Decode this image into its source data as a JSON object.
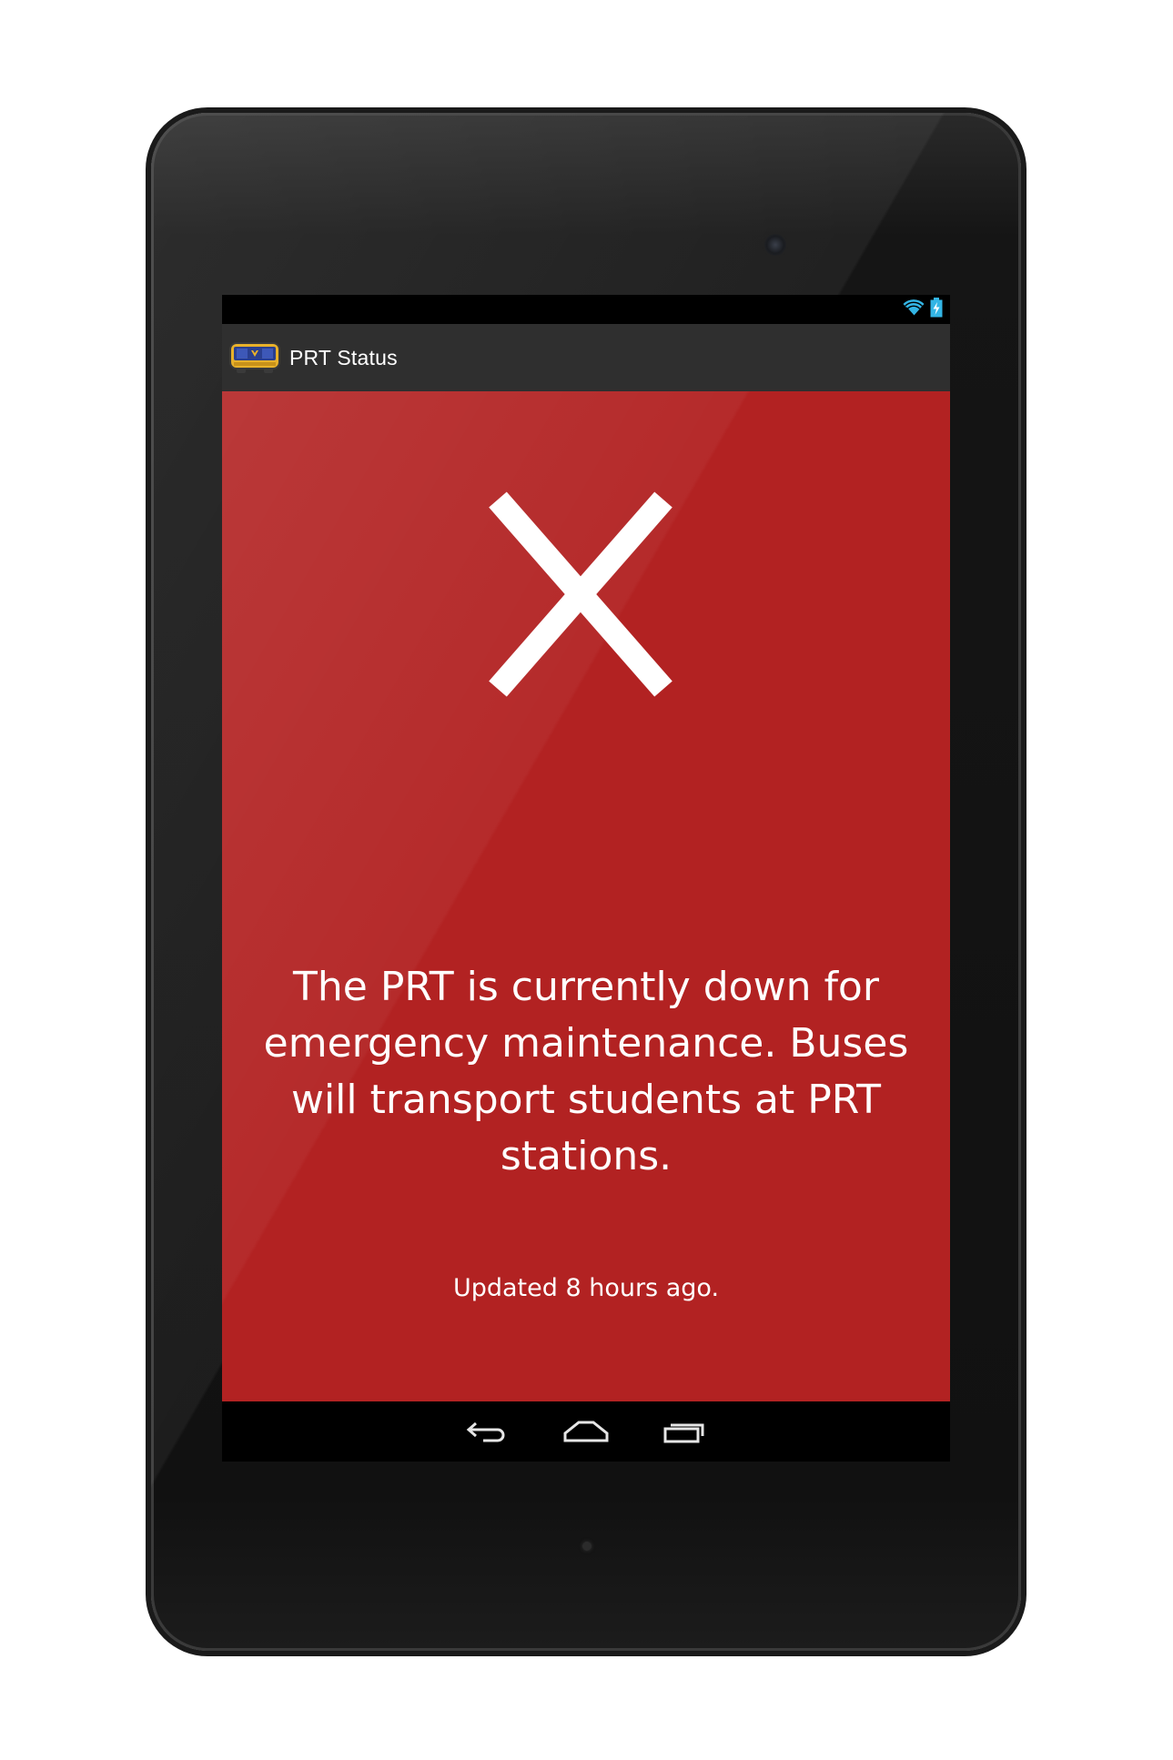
{
  "app": {
    "title": "PRT Status",
    "icon": "tram-icon"
  },
  "status_bar": {
    "icons": [
      "wifi-icon",
      "battery-charging-icon"
    ],
    "accent_color": "#33b5e5"
  },
  "status": {
    "state_icon": "close-x-icon",
    "background_color": "#b22222",
    "message": "The PRT is currently down for emergency maintenance. Buses will transport students at PRT stations.",
    "updated": "Updated 8 hours ago."
  },
  "nav_bar": {
    "buttons": [
      "back-icon",
      "home-icon",
      "recent-apps-icon"
    ]
  }
}
